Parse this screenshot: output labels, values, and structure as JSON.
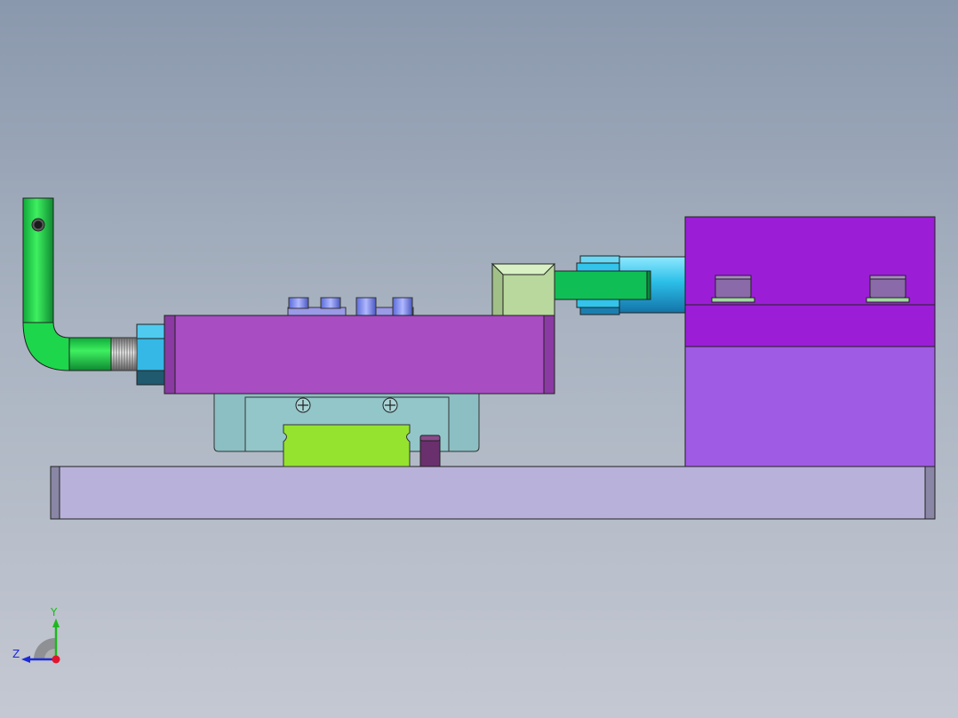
{
  "viewport": {
    "background_top": "#8a98ad",
    "background_bottom": "#c4c8d2"
  },
  "model": {
    "parts": [
      {
        "name": "base-plate",
        "color": "#b8b2da"
      },
      {
        "name": "slide-body",
        "color": "#a84dc2"
      },
      {
        "name": "linear-guide-carriage",
        "color": "#8bbfc3"
      },
      {
        "name": "guide-rail",
        "color": "#95e32f"
      },
      {
        "name": "locating-pin",
        "color": "#6a2f6d"
      },
      {
        "name": "hex-nut",
        "color": "#35b8e6"
      },
      {
        "name": "handle-rod",
        "color": "#1dd64b"
      },
      {
        "name": "end-block",
        "color": "#b8d89e"
      },
      {
        "name": "link-bar",
        "color": "#0fbf55"
      },
      {
        "name": "cylinder-barrel",
        "color": "#2bbfe8"
      },
      {
        "name": "clamp-block-upper",
        "color": "#9b1ed6"
      },
      {
        "name": "clamp-block-lower",
        "color": "#a05be4"
      },
      {
        "name": "bushing",
        "color": "#8a6aa8"
      }
    ]
  },
  "triad": {
    "y_label": "Y",
    "z_label": "Z",
    "y_color": "#1db81d",
    "z_color": "#1c2ad8",
    "x_color": "#e0152b"
  }
}
